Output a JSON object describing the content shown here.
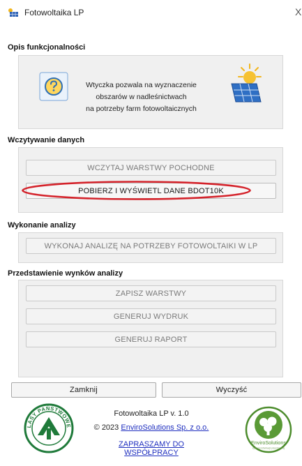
{
  "window": {
    "title": "Fotowoltaika LP",
    "close_glyph": "X",
    "icon": "solar-panel-icon"
  },
  "sections": {
    "description": {
      "title": "Opis funkcjonalności",
      "text_line1": "Wtyczka pozwala na wyznaczenie",
      "text_line2": "obszarów w nadleśnictwach",
      "text_line3": "na potrzeby farm fotowoltaicznych",
      "icon_left": "help-question-icon",
      "icon_right": "sun-solar-panel-icon"
    },
    "loading": {
      "title": "Wczytywanie danych",
      "btn_load_layers": "WCZYTAJ WARSTWY POCHODNE",
      "btn_fetch_bdot": "POBIERZ I WYŚWIETL DANE BDOT10K"
    },
    "analysis": {
      "title": "Wykonanie analizy",
      "btn_run": "WYKONAJ ANALIZĘ NA POTRZEBY FOTOWOLTAIKI W LP"
    },
    "results": {
      "title": "Przedstawienie wynków analizy",
      "btn_save": "ZAPISZ WARSTWY",
      "btn_print": "GENERUJ WYDRUK",
      "btn_report": "GENERUJ RAPORT"
    }
  },
  "bottom": {
    "btn_close": "Zamknij",
    "btn_clear": "Wyczyść"
  },
  "footer": {
    "version": "Fotowoltaika LP v. 1.0",
    "copyright_prefix": "© 2023 ",
    "company_link": "EnviroSolutions Sp. z o.o.",
    "cooperation_link": "ZAPRASZAMY DO WSPÓŁPRACY",
    "logo_left_text": "LASY PAŃSTWOWE",
    "logo_right_text": "EnviroSolutions",
    "logo_right_subtext": "systemy informacji przestrzennej"
  },
  "colors": {
    "highlight_ellipse": "#d4232b",
    "link": "#1f2fbf",
    "lp_green": "#1f7a3a",
    "es_green": "#4c8c2c"
  }
}
